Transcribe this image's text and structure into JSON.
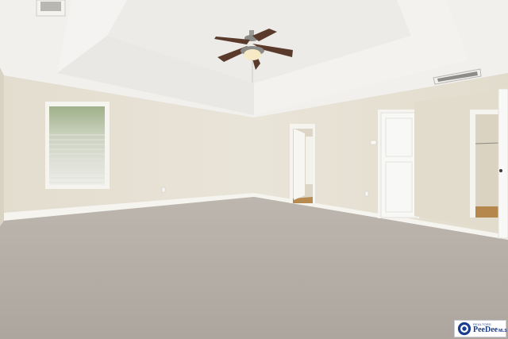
{
  "scene": {
    "description_colors": {
      "ceiling": "#f2f1ef",
      "tray_ceiling": "#ebeae7",
      "wall": "#e6e1d4",
      "wall_shadow": "#dcd6c8",
      "carpet": "#b8b1aa",
      "trim": "#f5f3ee",
      "door": "#f7f7f5",
      "fan_blade": "#5a3a2a"
    }
  },
  "watermark": {
    "top_text": "REALTORS",
    "main_text": "PeeDee",
    "suffix_text": "MLS",
    "brand_color": "#1a3d8f"
  }
}
